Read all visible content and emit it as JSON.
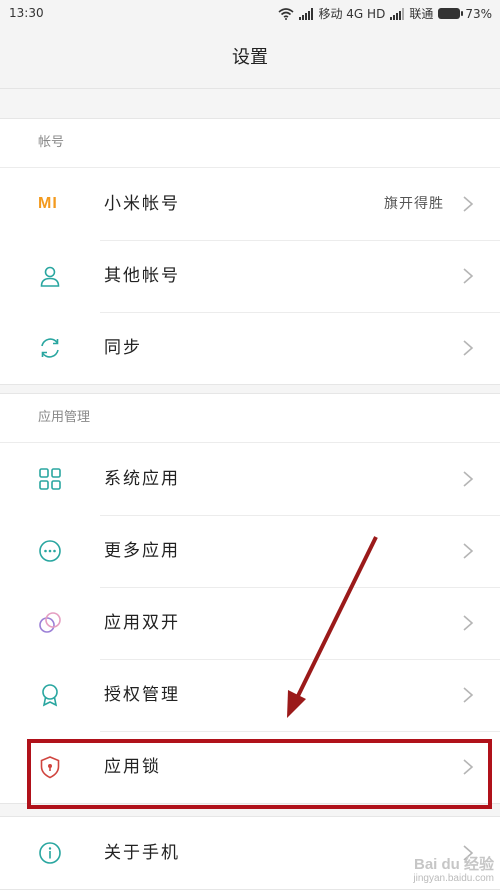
{
  "status": {
    "time": "13:30",
    "carrier1": "移动 4G HD",
    "carrier2": "联通",
    "battery": "73%"
  },
  "header": {
    "title": "设置"
  },
  "sections": [
    {
      "header": "帐号",
      "items": [
        {
          "label": "小米帐号",
          "value": "旗开得胜",
          "icon": "mi-logo-icon"
        },
        {
          "label": "其他帐号",
          "icon": "person-icon"
        },
        {
          "label": "同步",
          "icon": "sync-icon"
        }
      ]
    },
    {
      "header": "应用管理",
      "items": [
        {
          "label": "系统应用",
          "icon": "grid-icon"
        },
        {
          "label": "更多应用",
          "icon": "more-icon"
        },
        {
          "label": "应用双开",
          "icon": "dual-app-icon"
        },
        {
          "label": "授权管理",
          "icon": "badge-icon"
        },
        {
          "label": "应用锁",
          "icon": "shield-lock-icon"
        }
      ]
    },
    {
      "items": [
        {
          "label": "关于手机",
          "icon": "info-icon"
        }
      ]
    }
  ],
  "annotation": {
    "color": "#b0111a",
    "target": "应用锁"
  },
  "watermark": {
    "brand": "Bai du 经验",
    "url": "jingyan.baidu.com"
  },
  "colors": {
    "accent_teal": "#29a6a0",
    "mi_orange": "#f39a1e",
    "lock_red": "#d0453f",
    "dual_purple": "#9b7fd6"
  }
}
